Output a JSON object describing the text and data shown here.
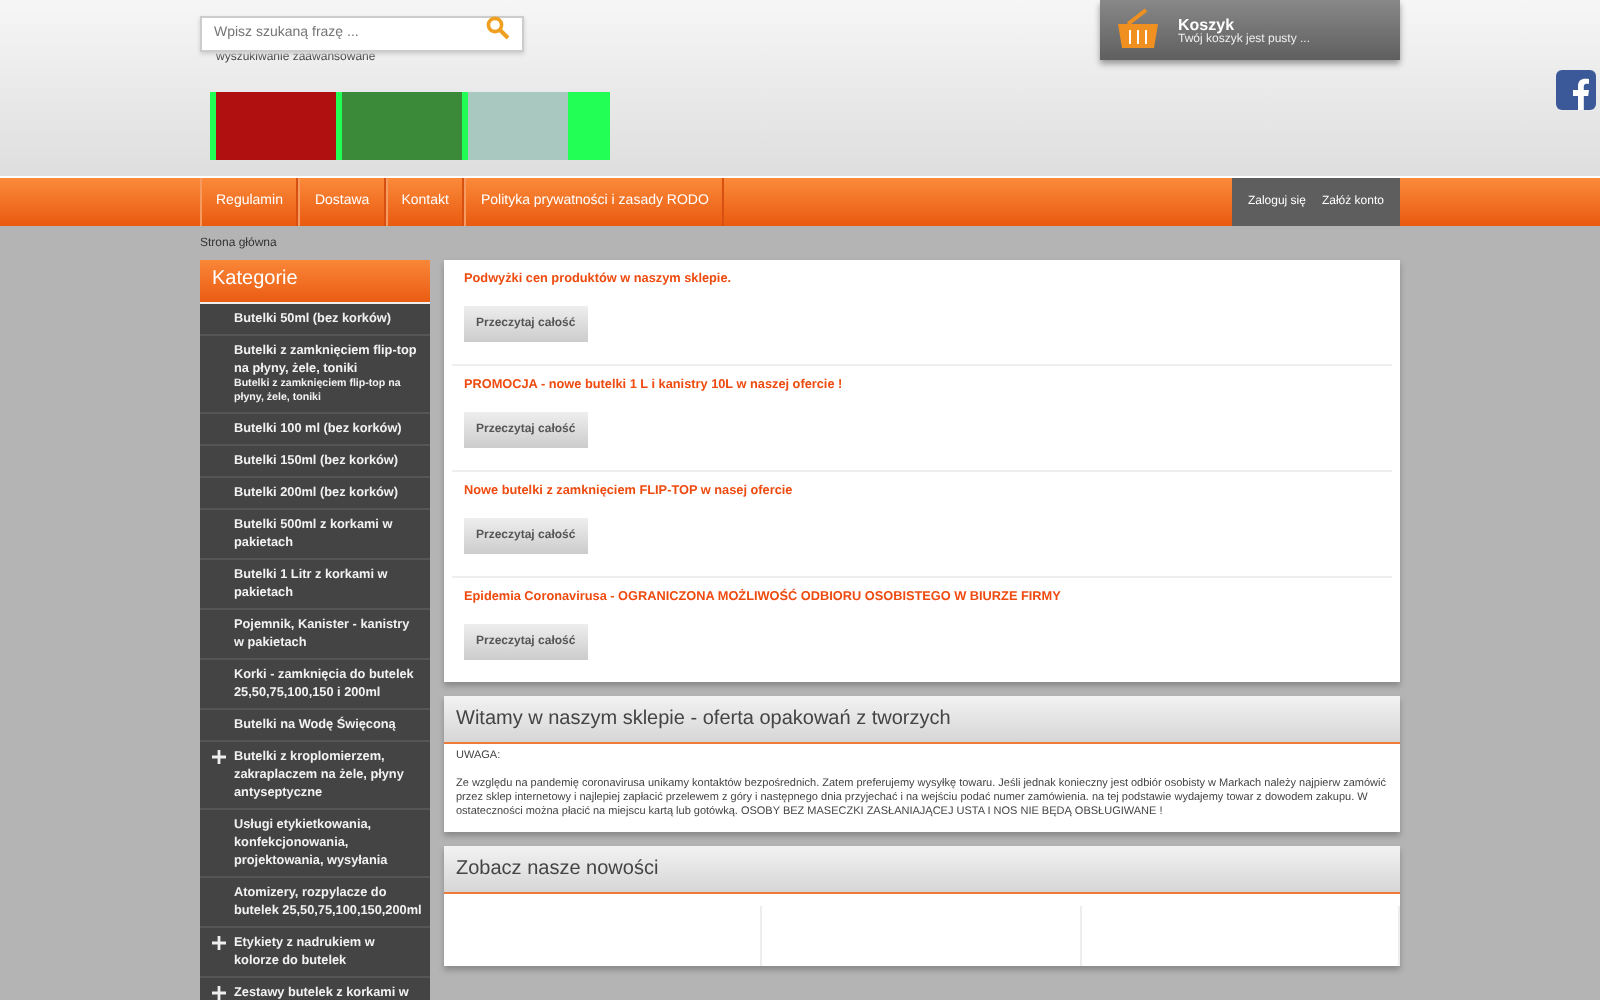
{
  "search": {
    "placeholder": "Wpisz szukaną frazę ...",
    "advanced_link": "wyszukiwanie zaawansowane"
  },
  "cart": {
    "title": "Koszyk",
    "status": "Twój koszyk jest pusty ..."
  },
  "nav": {
    "items": [
      "Regulamin",
      "Dostawa",
      "Kontakt",
      "Polityka prywatności i zasady RODO"
    ],
    "account": [
      "Zaloguj się",
      "Załóż konto"
    ]
  },
  "breadcrumb": "Strona główna",
  "sidebar": {
    "title": "Kategorie",
    "items": [
      {
        "label": "Butelki 50ml (bez korków)",
        "expandable": false
      },
      {
        "label": "Butelki z zamknięciem flip-top na płyny, żele, toniki",
        "subtitle": "Butelki z zamknięciem flip-top na płyny, żele, toniki",
        "expandable": false
      },
      {
        "label": "Butelki 100 ml (bez korków)",
        "expandable": false
      },
      {
        "label": "Butelki 150ml (bez korków)",
        "expandable": false
      },
      {
        "label": "Butelki 200ml (bez korków)",
        "expandable": false
      },
      {
        "label": "Butelki 500ml z korkami w pakietach",
        "expandable": false
      },
      {
        "label": "Butelki 1 Litr z korkami w pakietach",
        "expandable": false
      },
      {
        "label": "Pojemnik, Kanister - kanistry w pakietach",
        "expandable": false
      },
      {
        "label": "Korki - zamknięcia do butelek 25,50,75,100,150 i 200ml",
        "expandable": false
      },
      {
        "label": "Butelki na Wodę Święconą",
        "expandable": false
      },
      {
        "label": "Butelki z kroplomierzem, zakraplaczem na żele, płyny antyseptyczne",
        "expandable": true
      },
      {
        "label": "Usługi etykietkowania, konfekcjonowania, projektowania, wysyłania",
        "expandable": false
      },
      {
        "label": "Atomizery, rozpylacze do butelek 25,50,75,100,150,200ml",
        "expandable": false
      },
      {
        "label": "Etykiety z nadrukiem w kolorze do butelek",
        "expandable": true
      },
      {
        "label": "Zestawy butelek z korkami w",
        "expandable": true
      }
    ]
  },
  "news": [
    {
      "title": "Podwyżki cen produktów w naszym sklepie.",
      "button": "Przeczytaj całość"
    },
    {
      "title": "PROMOCJA - nowe butelki 1 L i kanistry 10L w naszej ofercie !",
      "button": "Przeczytaj całość"
    },
    {
      "title": "Nowe butelki z zamknięciem FLIP-TOP w nasej ofercie",
      "button": "Przeczytaj całość"
    },
    {
      "title": "Epidemia Coronavirusa - OGRANICZONA MOŻLIWOŚĆ ODBIORU OSOBISTEGO W BIURZE FIRMY",
      "button": "Przeczytaj całość"
    }
  ],
  "welcome": {
    "title": "Witamy w naszym sklepie - oferta opakowań z tworzych",
    "notice": "UWAGA:",
    "body": "Ze względu na pandemię coronavirusa unikamy kontaktów bezpośrednich. Zatem preferujemy wysyłkę towaru. Jeśli jednak konieczny jest odbiór osobisty w Markach należy najpierw zamówić przez sklep internetowy i najlepiej zapłacić przelewem z góry i następnego dnia przyjechać i na wejściu podać numer zamówienia. na tej podstawie wydajemy towar z dowodem zakupu. W ostateczności można płacić na miejscu kartą lub gotówką. OSOBY BEZ MASECZKI ZASŁANIAJĄCEJ USTA I NOS NIE BĘDĄ OBSŁUGIWANE !"
  },
  "new_products": {
    "title": "Zobacz nasze nowości"
  }
}
